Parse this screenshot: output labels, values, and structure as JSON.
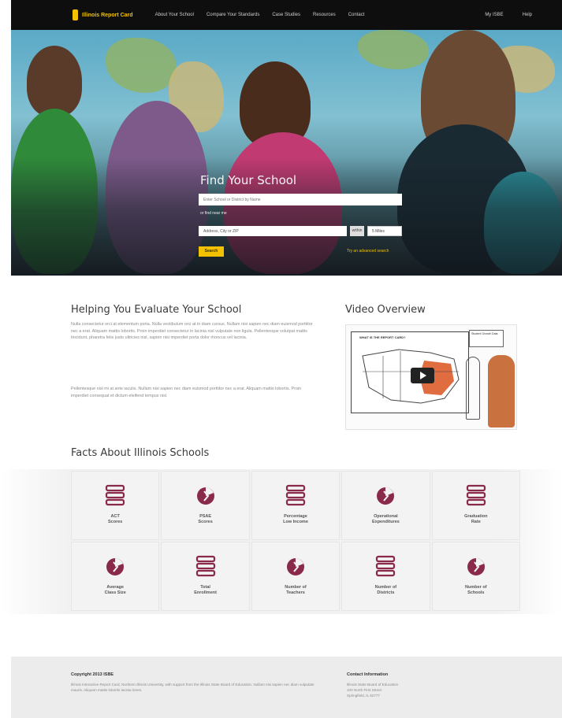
{
  "nav": {
    "logo": "Illinois Report Card",
    "links": [
      "About Your School",
      "Compare Your Standards",
      "Case Studies",
      "Resources",
      "Contact"
    ],
    "right": [
      "My ISBE",
      "Help"
    ]
  },
  "hero": {
    "title": "Find Your School",
    "search_placeholder": "Enter School or District by Name",
    "near_label": "or find near me",
    "location_value": "Address, City or ZIP",
    "within_label": "within",
    "miles_value": "5 Miles",
    "go_label": "Search",
    "advanced_link": "Try an advanced search"
  },
  "intro": {
    "heading": "Helping You Evaluate Your School",
    "para1": "Nulla consectetur orci at elementum porta. Nulla vestibulum orci at in diam cursus. Nullam nisi sapien nec diam euismod porttitor nec a erat. Aliquam mattis lobortis. Proin imperdiet consectetur in lacinia nisl vulputate non ligula. Pellentesque volutpat mattis tincidunt, pharetra felis justo ultricies nisl, sapien nisi imperdiet porta dolor rhoncus vel lacinia.",
    "para2": "Pellentesque nisl mi at ante iaculis. Nullam nisi sapien nec diam euismod porttitor nec a erat. Aliquam mattis lobortis. Proin imperdiet consequat et dictum eleifend tempus nisl."
  },
  "video": {
    "heading": "Video Overview",
    "board_title": "WHAT IS THE REPORT CARD?",
    "note": "Student Growth Data"
  },
  "facts": {
    "heading": "Facts About Illinois Schools",
    "items": [
      {
        "label": "ACT\nScores",
        "icon": "books-icon"
      },
      {
        "label": "PSAE\nScores",
        "icon": "pie-chart-icon"
      },
      {
        "label": "Percentage\nLow Income",
        "icon": "books-icon"
      },
      {
        "label": "Operational\nExpenditures",
        "icon": "pie-chart-icon"
      },
      {
        "label": "Graduation\nRate",
        "icon": "books-icon"
      },
      {
        "label": "Average\nClass Size",
        "icon": "pie-chart-icon"
      },
      {
        "label": "Total\nEnrollment",
        "icon": "books-icon"
      },
      {
        "label": "Number of\nTeachers",
        "icon": "pie-chart-icon"
      },
      {
        "label": "Number of\nDistricts",
        "icon": "books-icon"
      },
      {
        "label": "Number of\nSchools",
        "icon": "pie-chart-icon"
      }
    ],
    "accent": "#8a2a4a"
  },
  "footer": {
    "left_heading": "Copyright 2013 ISBE",
    "left_text": "Illinois Interactive Report Card, Northern Illinois University, with support from the Illinois State Board of Education. Nullam nisi sapien nec diam vulputate mauris. Aliquam mattis lobortis lacinia lorem.",
    "right_heading": "Contact Information",
    "right_lines": [
      "Illinois State Board of Education",
      "100 North First Street",
      "Springfield, IL 62777"
    ]
  },
  "colors": {
    "nav_bg": "#0e0e0e",
    "brand_yellow": "#f2c200"
  }
}
